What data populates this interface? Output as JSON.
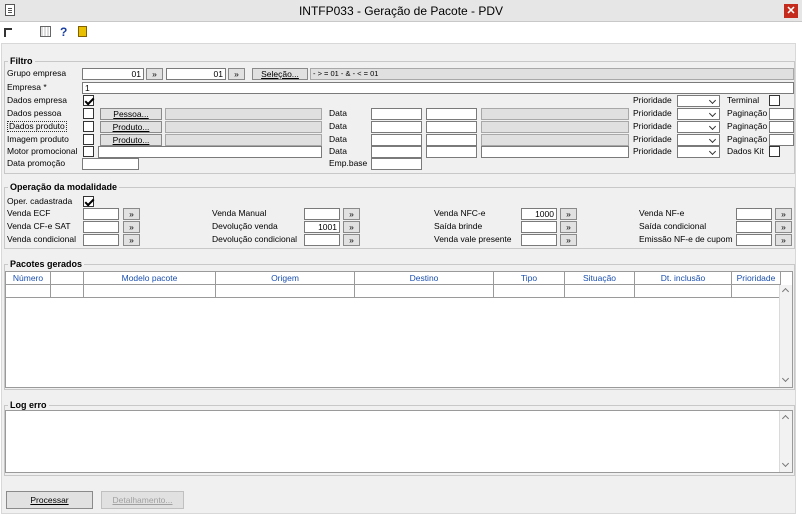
{
  "window": {
    "title": "INTFP033 - Geração de Pacote - PDV",
    "close": "✕"
  },
  "toolbar": {
    "help": "?"
  },
  "filtro": {
    "legend": "Filtro",
    "grupo_label": "Grupo empresa",
    "grupo_from": "01",
    "grupo_to": "01",
    "nav": "»",
    "selecao": "Seleção...",
    "summary": "- > = 01  - & - < = 01",
    "empresa_label": "Empresa *",
    "empresa_value": "1",
    "dados_empresa": "Dados empresa",
    "dados_pessoa": "Dados pessoa",
    "dados_produto": "Dados produto",
    "imagem_produto": "Imagem produto",
    "motor_promocional": "Motor promocional",
    "data_promocao": "Data promoção",
    "pessoa_btn": "Pessoa...",
    "produto_btn": "Produto...",
    "data_label": "Data",
    "emp_base": "Emp.base",
    "prioridade": "Prioridade",
    "terminal": "Terminal",
    "paginacao": "Paginação",
    "dados_kit": "Dados Kit"
  },
  "operacao": {
    "legend": "Operação da modalidade",
    "oper_cadastrada": "Oper. cadastrada",
    "nav": "»",
    "venda_ecf": "Venda ECF",
    "venda_cfe_sat": "Venda CF-e SAT",
    "venda_condicional": "Venda condicional",
    "venda_manual": "Venda Manual",
    "devolucao_venda": "Devolução venda",
    "devolucao_venda_value": "1001",
    "devolucao_condicional": "Devolução condicional",
    "venda_nfce": "Venda NFC-e",
    "venda_nfce_value": "1000",
    "saida_brinde": "Saída brinde",
    "venda_vale_presente": "Venda vale presente",
    "venda_nfe": "Venda NF-e",
    "saida_condicional": "Saída condicional",
    "emissao_nfe_cupom": "Emissão NF-e de cupom"
  },
  "pacotes": {
    "legend": "Pacotes gerados",
    "columns": [
      "Número",
      "Modelo pacote",
      "Origem",
      "Destino",
      "Tipo",
      "Situação",
      "Dt. inclusão",
      "Prioridade"
    ]
  },
  "log": {
    "legend": "Log erro"
  },
  "footer": {
    "processar": "Processar",
    "detalhamento": "Detalhamento..."
  }
}
